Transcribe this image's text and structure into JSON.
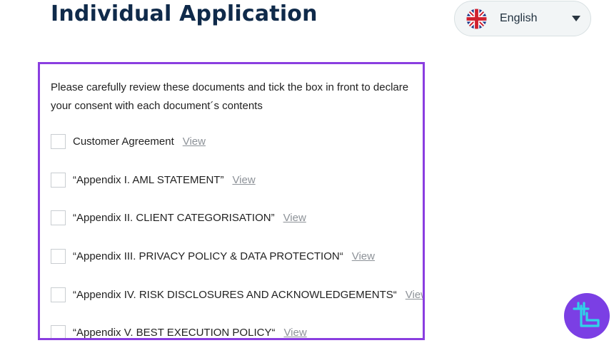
{
  "header": {
    "title": "Individual Application"
  },
  "language_selector": {
    "selected": "English",
    "flag_icon": "uk-flag-icon",
    "caret_icon": "chevron-down-icon"
  },
  "consent": {
    "intro_line_1": "Please carefully review these documents and tick the box in front to declare",
    "intro_line_2": "your consent with each document´s contents",
    "border_color": "#8a3ee0",
    "documents": [
      {
        "name": "Customer Agreement",
        "link": "View",
        "checked": false
      },
      {
        "name": "“Appendix I. AML STATEMENT”",
        "link": "View",
        "checked": false
      },
      {
        "name": "“Appendix II. CLIENT CATEGORISATION”",
        "link": "View",
        "checked": false
      },
      {
        "name": "“Appendix III. PRIVACY POLICY & DATA PROTECTION“",
        "link": "View",
        "checked": false
      },
      {
        "name": "“Appendix IV. RISK DISCLOSURES AND ACKNOWLEDGEMENTS“",
        "link": "View",
        "checked": false
      },
      {
        "name": "“Appendix V. BEST EXECUTION POLICY“",
        "link": "View",
        "checked": false
      }
    ]
  },
  "colors": {
    "title": "#0f2a4a",
    "link": "#8d9298",
    "logo_bg": "#7b3fe4",
    "logo_mark": "#2fd4e8"
  }
}
